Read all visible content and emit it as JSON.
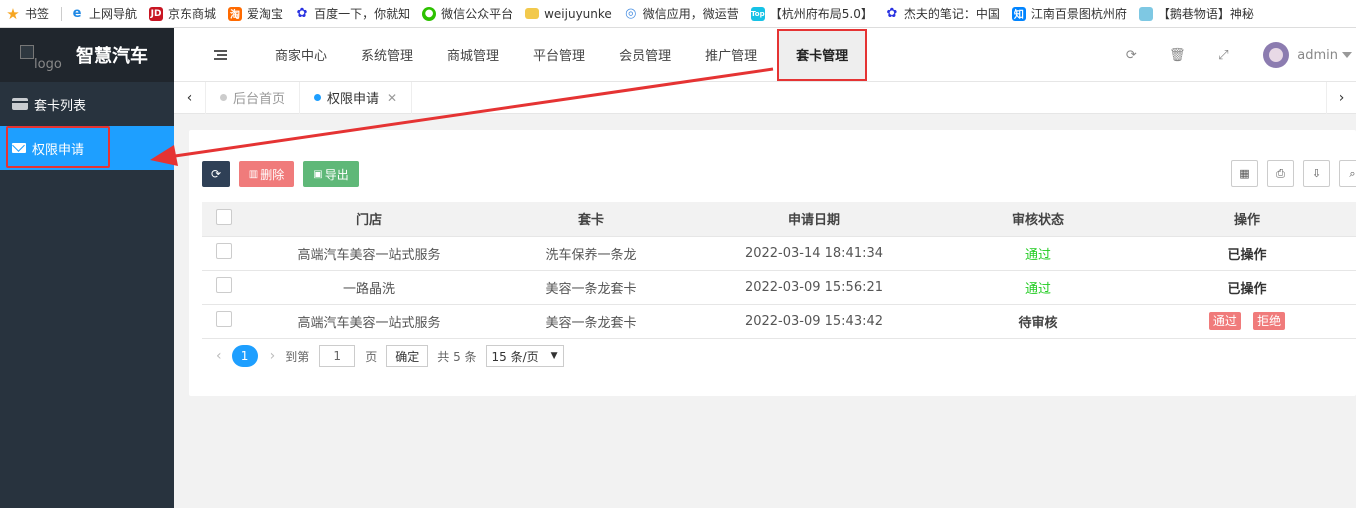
{
  "bookmarks": [
    {
      "label": "书签",
      "icon": "star-icon",
      "color": "#f6a623"
    },
    {
      "label": "上网导航",
      "icon": "ie-icon",
      "color": "#1e88e5"
    },
    {
      "label": "京东商城",
      "icon": "jd-icon",
      "color": "#c81623"
    },
    {
      "label": "爱淘宝",
      "icon": "taobao-icon",
      "color": "#ff6a00"
    },
    {
      "label": "百度一下，你就知",
      "icon": "baidu-icon",
      "color": "#2932e1"
    },
    {
      "label": "微信公众平台",
      "icon": "wechat-icon",
      "color": "#2dc100"
    },
    {
      "label": "weijuyunke",
      "icon": "folder-icon",
      "color": "#f2c94c"
    },
    {
      "label": "微信应用，微运营",
      "icon": "swirl-icon",
      "color": "#4a90e2"
    },
    {
      "label": "【杭州府布局5.0】",
      "icon": "top-icon",
      "color": "#16c2e6"
    },
    {
      "label": "杰夫的笔记：中国",
      "icon": "baidu-icon",
      "color": "#2932e1"
    },
    {
      "label": "江南百景图杭州府",
      "icon": "zhihu-icon",
      "color": "#0084ff"
    },
    {
      "label": "【鹅巷物语】神秘",
      "icon": "game-icon",
      "color": "#7ec8e3"
    }
  ],
  "sidebar": {
    "logo_alt": "logo",
    "title": "智慧汽车",
    "items": [
      {
        "label": "套卡列表",
        "icon": "card-icon"
      },
      {
        "label": "权限申请",
        "icon": "mail-icon"
      }
    ]
  },
  "topnav": {
    "items": [
      "商家中心",
      "系统管理",
      "商城管理",
      "平台管理",
      "会员管理",
      "推广管理",
      "套卡管理"
    ],
    "current": "套卡管理",
    "user": "admin"
  },
  "tabs": {
    "items": [
      {
        "label": "后台首页",
        "active": false
      },
      {
        "label": "权限申请",
        "active": true
      }
    ]
  },
  "toolbar": {
    "delete_label": "删除",
    "export_label": "导出"
  },
  "table": {
    "headers": [
      "门店",
      "套卡",
      "申请日期",
      "审核状态",
      "操作"
    ],
    "rows": [
      {
        "store": "高端汽车美容一站式服务",
        "card": "洗车保养一条龙",
        "date": "2022-03-14 18:41:34",
        "status": "通过",
        "action": "已操作"
      },
      {
        "store": "一路晶洗",
        "card": "美容一条龙套卡",
        "date": "2022-03-09 15:56:21",
        "status": "通过",
        "action": "已操作"
      },
      {
        "store": "高端汽车美容一站式服务",
        "card": "美容一条龙套卡",
        "date": "2022-03-09 15:43:42",
        "status": "待审核",
        "approve_label": "通过",
        "reject_label": "拒绝"
      }
    ]
  },
  "pagination": {
    "current_page": "1",
    "goto_label": "到第",
    "page_input": "1",
    "page_unit": "页",
    "confirm_label": "确定",
    "total_label": "共 5 条",
    "page_size": "15 条/页"
  },
  "colors": {
    "sidebar_bg": "#28333e",
    "accent": "#1e9fff",
    "danger": "#f07b7b",
    "success": "#5fb878",
    "annotation": "#e53333"
  }
}
